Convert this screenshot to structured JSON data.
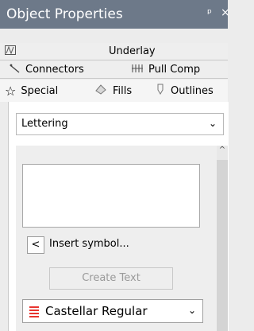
{
  "panel": {
    "title": "Object Properties",
    "pin_glyph": "ᵖ",
    "close_glyph": "×"
  },
  "tabs": {
    "row1": [
      {
        "label": "Underlay",
        "icon": "underlay-icon"
      }
    ],
    "row2": [
      {
        "label": "Connectors",
        "icon": "connector-icon"
      },
      {
        "label": "Pull Comp",
        "icon": "pull-comp-icon"
      }
    ],
    "row3": [
      {
        "label": "Special",
        "icon": "star-icon",
        "selected": true
      },
      {
        "label": "Fills",
        "icon": "fill-icon"
      },
      {
        "label": "Outlines",
        "icon": "outline-icon"
      }
    ]
  },
  "special": {
    "type_value": "Lettering",
    "text_value": "",
    "insert_arrow": "<",
    "insert_label": "Insert symbol...",
    "create_label": "Create Text",
    "font_value": "Castellar Regular"
  },
  "colors": {
    "titlebar": "#6d7989",
    "font_icon": "#e8342f"
  }
}
